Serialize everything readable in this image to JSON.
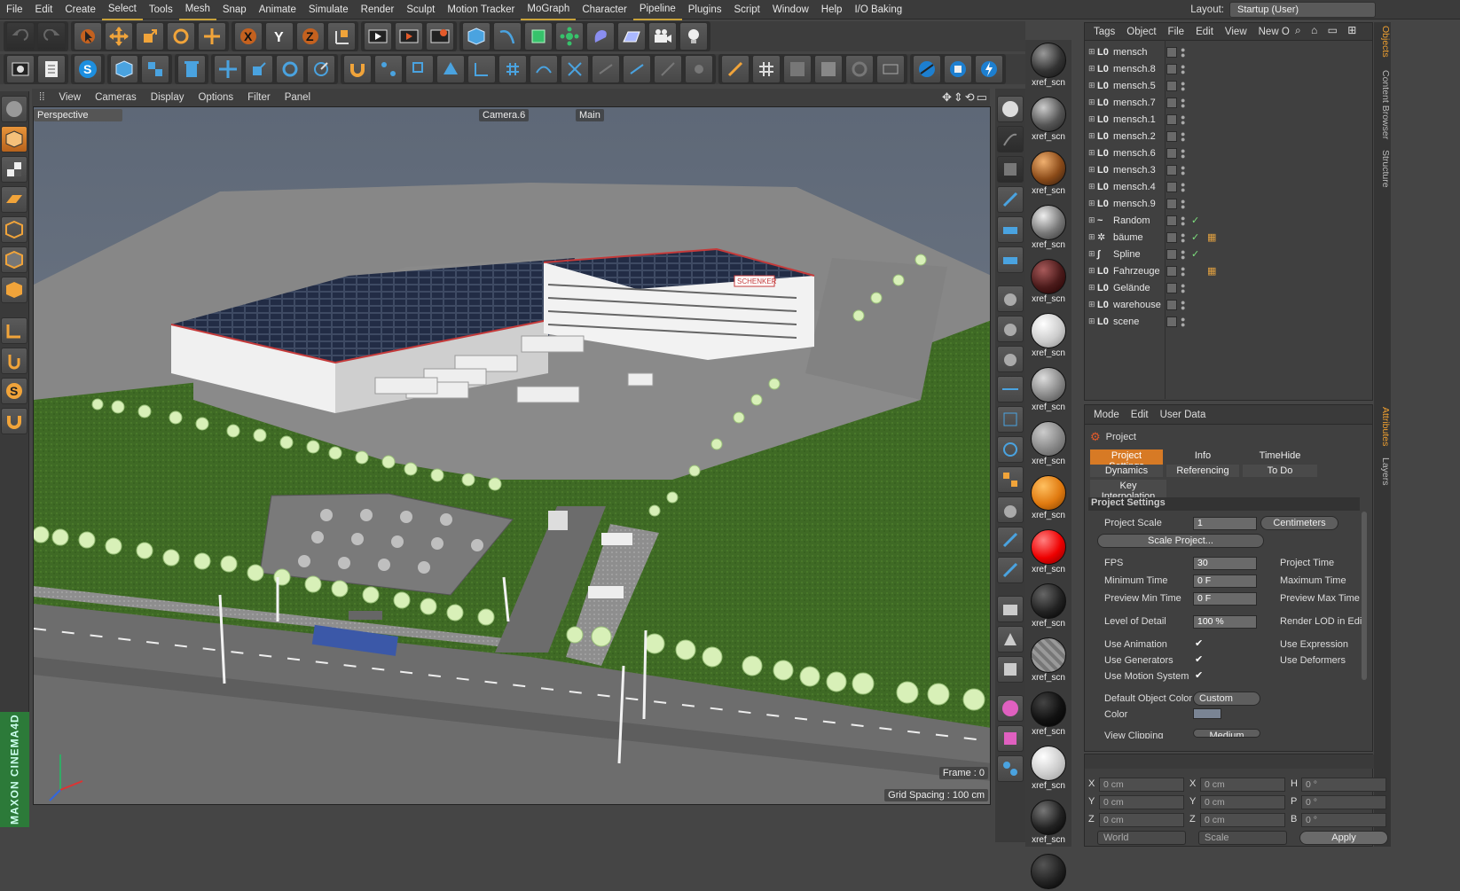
{
  "menu": [
    "File",
    "Edit",
    "Create",
    "Select",
    "Tools",
    "Mesh",
    "Snap",
    "Animate",
    "Simulate",
    "Render",
    "Sculpt",
    "Motion Tracker",
    "MoGraph",
    "Character",
    "Pipeline",
    "Plugins",
    "Script",
    "Window",
    "Help",
    "I/O Baking"
  ],
  "layout": {
    "label": "Layout:",
    "value": "Startup (User)"
  },
  "viewport_menu": [
    "View",
    "Cameras",
    "Display",
    "Options",
    "Filter",
    "Panel"
  ],
  "viewport": {
    "view_name": "Perspective",
    "camera": "Camera.6",
    "main": "Main",
    "frame": "Frame : 0",
    "grid": "Grid Spacing : 100 cm",
    "logo_text": "MAXON CINEMA4D",
    "sign_text": "SCHENKER"
  },
  "object_panel": {
    "menu": [
      "Tags",
      "Object",
      "File",
      "Edit",
      "View",
      "New O"
    ],
    "objects": [
      {
        "name": "mensch",
        "icon": "L0",
        "check": false,
        "tag": false
      },
      {
        "name": "mensch.8",
        "icon": "L0",
        "check": false,
        "tag": false
      },
      {
        "name": "mensch.5",
        "icon": "L0",
        "check": false,
        "tag": false
      },
      {
        "name": "mensch.7",
        "icon": "L0",
        "check": false,
        "tag": false
      },
      {
        "name": "mensch.1",
        "icon": "L0",
        "check": false,
        "tag": false
      },
      {
        "name": "mensch.2",
        "icon": "L0",
        "check": false,
        "tag": false
      },
      {
        "name": "mensch.6",
        "icon": "L0",
        "check": false,
        "tag": false
      },
      {
        "name": "mensch.3",
        "icon": "L0",
        "check": false,
        "tag": false
      },
      {
        "name": "mensch.4",
        "icon": "L0",
        "check": false,
        "tag": false
      },
      {
        "name": "mensch.9",
        "icon": "L0",
        "check": false,
        "tag": false
      },
      {
        "name": "Random",
        "icon": "~",
        "check": true,
        "tag": false
      },
      {
        "name": "bäume",
        "icon": "✲",
        "check": true,
        "tag": true
      },
      {
        "name": "Spline",
        "icon": "∫",
        "check": true,
        "tag": false
      },
      {
        "name": "Fahrzeuge",
        "icon": "L0",
        "check": false,
        "tag": true
      },
      {
        "name": "Gelände",
        "icon": "L0",
        "check": false,
        "tag": false
      },
      {
        "name": "warehouse",
        "icon": "L0",
        "check": false,
        "tag": false
      },
      {
        "name": "scene",
        "icon": "L0",
        "check": false,
        "tag": false
      }
    ]
  },
  "right_tabs": [
    "Objects",
    "Content Browser",
    "Structure",
    "Attributes",
    "Layers"
  ],
  "materials": [
    "xref_scn",
    "xref_scn",
    "xref_scn",
    "xref_scn",
    "xref_scn",
    "xref_scn",
    "xref_scn",
    "xref_scn",
    "xref_scn",
    "xref_scn",
    "xref_scn",
    "xref_scn",
    "xref_scn",
    "xref_scn",
    "xref_scn",
    ""
  ],
  "attributes": {
    "menu": [
      "Mode",
      "Edit",
      "User Data"
    ],
    "object": "Project",
    "tabs": [
      "Project Settings",
      "Info",
      "TimeHide",
      "Dynamics",
      "Referencing",
      "To Do",
      "Key Interpolation"
    ],
    "section": "Project Settings",
    "project_scale_label": "Project Scale",
    "project_scale_value": "1",
    "project_scale_unit": "Centimeters",
    "scale_button": "Scale Project...",
    "fps_label": "FPS",
    "fps": "30",
    "min_time_label": "Minimum Time",
    "min_time": "0 F",
    "prev_min_label": "Preview Min Time",
    "prev_min": "0 F",
    "lod_label": "Level of Detail",
    "lod": "100 %",
    "right_labels": [
      "Project Time",
      "Maximum Time",
      "Preview Max Time",
      "Render LOD in Edi",
      "Use Expression",
      "Use Deformers"
    ],
    "use_anim": "Use Animation",
    "use_gen": "Use Generators",
    "use_motion": "Use Motion System",
    "def_color_label": "Default Object Color",
    "def_color": "Custom",
    "color_label": "Color",
    "clipping_label": "View Clipping",
    "clipping": "Medium"
  },
  "coords": {
    "rows": [
      {
        "a": "X",
        "av": "0 cm",
        "b": "X",
        "bv": "0 cm",
        "c": "H",
        "cv": "0 °"
      },
      {
        "a": "Y",
        "av": "0 cm",
        "b": "Y",
        "bv": "0 cm",
        "c": "P",
        "cv": "0 °"
      },
      {
        "a": "Z",
        "av": "0 cm",
        "b": "Z",
        "bv": "0 cm",
        "c": "B",
        "cv": "0 °"
      }
    ],
    "world": "World",
    "scale": "Scale",
    "apply": "Apply"
  }
}
